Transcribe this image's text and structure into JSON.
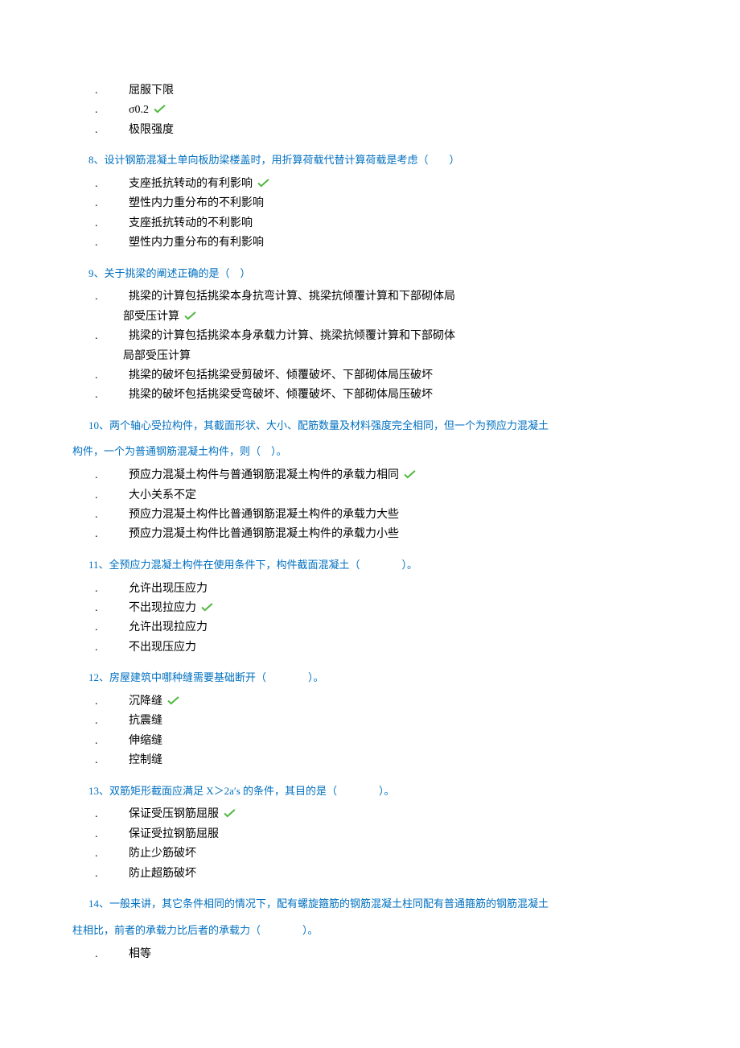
{
  "q7_options": [
    {
      "text": "屈服下限",
      "correct": false
    },
    {
      "text": "σ0.2",
      "correct": true
    },
    {
      "text": "极限强度",
      "correct": false
    }
  ],
  "q8": {
    "title": "8、设计钢筋混凝土单向板肋梁楼盖时，用折算荷载代替计算荷载是考虑（　　）",
    "options": [
      {
        "text": "支座抵抗转动的有利影响",
        "correct": true
      },
      {
        "text": "塑性内力重分布的不利影响",
        "correct": false
      },
      {
        "text": "支座抵抗转动的不利影响",
        "correct": false
      },
      {
        "text": "塑性内力重分布的有利影响",
        "correct": false
      }
    ]
  },
  "q9": {
    "title": "9、关于挑梁的阐述正确的是（　）",
    "options": [
      {
        "text": "挑梁的计算包括挑梁本身抗弯计算、挑梁抗倾覆计算和下部砌体局部受压计算",
        "correct": true,
        "multiline": true,
        "line1": "挑梁的计算包括挑梁本身抗弯计算、挑梁抗倾覆计算和下部砌体局",
        "line2": "部受压计算"
      },
      {
        "text": "挑梁的计算包括挑梁本身承载力计算、挑梁抗倾覆计算和下部砌体局部受压计算",
        "correct": false,
        "multiline": true,
        "line1": "挑梁的计算包括挑梁本身承载力计算、挑梁抗倾覆计算和下部砌体",
        "line2": "局部受压计算"
      },
      {
        "text": "挑梁的破坏包括挑梁受剪破坏、倾覆破坏、下部砌体局压破坏",
        "correct": false
      },
      {
        "text": "挑梁的破坏包括挑梁受弯破坏、倾覆破坏、下部砌体局压破坏",
        "correct": false
      }
    ]
  },
  "q10": {
    "title_line1": "10、两个轴心受拉构件，其截面形状、大小、配筋数量及材料强度完全相同，但一个为预应力混凝土",
    "title_line2": "构件，一个为普通钢筋混凝土构件，则（　）。",
    "options": [
      {
        "text": "预应力混凝土构件与普通钢筋混凝土构件的承载力相同",
        "correct": true
      },
      {
        "text": "大小关系不定",
        "correct": false
      },
      {
        "text": "预应力混凝土构件比普通钢筋混凝土构件的承载力大些",
        "correct": false
      },
      {
        "text": "预应力混凝土构件比普通钢筋混凝土构件的承载力小些",
        "correct": false
      }
    ]
  },
  "q11": {
    "title": "11、全预应力混凝土构件在使用条件下，构件截面混凝土（　　　　）。",
    "options": [
      {
        "text": "允许出现压应力",
        "correct": false
      },
      {
        "text": "不出现拉应力",
        "correct": true
      },
      {
        "text": "允许出现拉应力",
        "correct": false
      },
      {
        "text": "不出现压应力",
        "correct": false
      }
    ]
  },
  "q12": {
    "title": "12、房屋建筑中哪种缝需要基础断开（　　　　）。",
    "options": [
      {
        "text": "沉降缝",
        "correct": true
      },
      {
        "text": "抗震缝",
        "correct": false
      },
      {
        "text": "伸缩缝",
        "correct": false
      },
      {
        "text": "控制缝",
        "correct": false
      }
    ]
  },
  "q13": {
    "title": "13、双筋矩形截面应满足 X＞2a′s 的条件，其目的是（　　　　）。",
    "options": [
      {
        "text": "保证受压钢筋屈服",
        "correct": true
      },
      {
        "text": "保证受拉钢筋屈服",
        "correct": false
      },
      {
        "text": "防止少筋破坏",
        "correct": false
      },
      {
        "text": "防止超筋破坏",
        "correct": false
      }
    ]
  },
  "q14": {
    "title_line1": "14、一般来讲，其它条件相同的情况下，配有螺旋箍筋的钢筋混凝土柱同配有普通箍筋的钢筋混凝土",
    "title_line2": "柱相比，前者的承载力比后者的承载力（　　　　）。",
    "options": [
      {
        "text": "相等",
        "correct": false
      }
    ]
  }
}
